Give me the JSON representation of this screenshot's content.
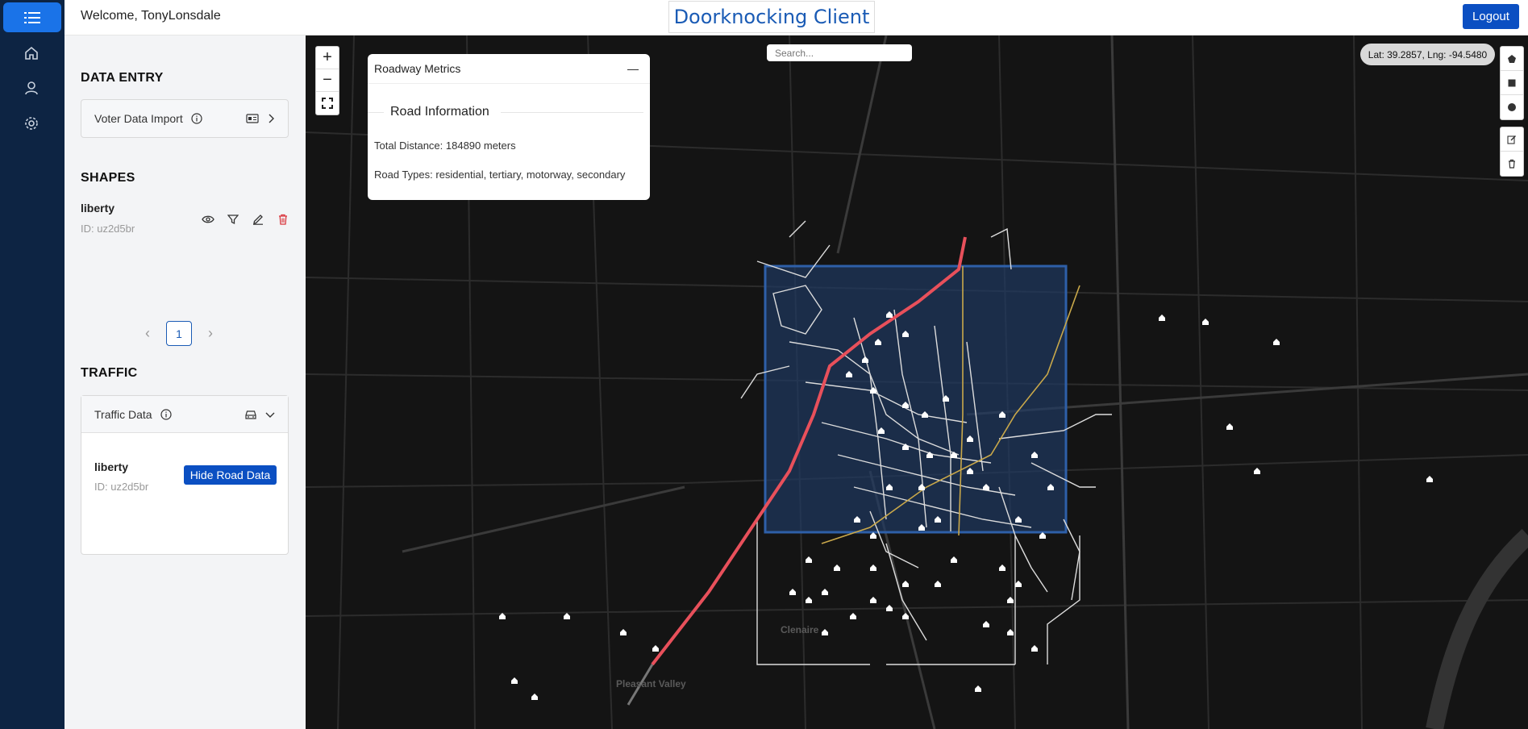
{
  "header": {
    "welcome": "Welcome, TonyLonsdale",
    "brand": "Doorknocking Client",
    "logout_label": "Logout"
  },
  "nav": {
    "icons": [
      "menu-icon",
      "home-icon",
      "user-icon",
      "gear-icon"
    ]
  },
  "sidebar": {
    "data_entry": {
      "title": "DATA ENTRY",
      "item_label": "Voter Data Import"
    },
    "shapes": {
      "title": "SHAPES",
      "items": [
        {
          "name": "liberty",
          "id": "ID: uz2d5br"
        }
      ]
    },
    "pagination": {
      "prev": "‹",
      "current": "1",
      "next": "›"
    },
    "traffic": {
      "title": "TRAFFIC",
      "header_label": "Traffic Data",
      "item_name": "liberty",
      "item_id": "ID: uz2d5br",
      "hide_button": "Hide Road Data"
    }
  },
  "map": {
    "zoom_in": "+",
    "zoom_out": "−",
    "search_placeholder": "Search...",
    "coords": "Lat: 39.2857, Lng: -94.5480",
    "places": [
      "Clenaire",
      "Pleasant Valley"
    ],
    "metrics": {
      "title": "Roadway Metrics",
      "minimize": "—",
      "section": "Road Information",
      "total_distance": "Total Distance: 184890 meters",
      "road_types": "Road Types: residential, tertiary, motorway, secondary"
    },
    "colors": {
      "map_bg": "#141414",
      "selection_fill": "#1f3a66",
      "selection_border": "#2e5fa8",
      "motorway": "#e8505b",
      "secondary": "#c9a84a"
    }
  }
}
